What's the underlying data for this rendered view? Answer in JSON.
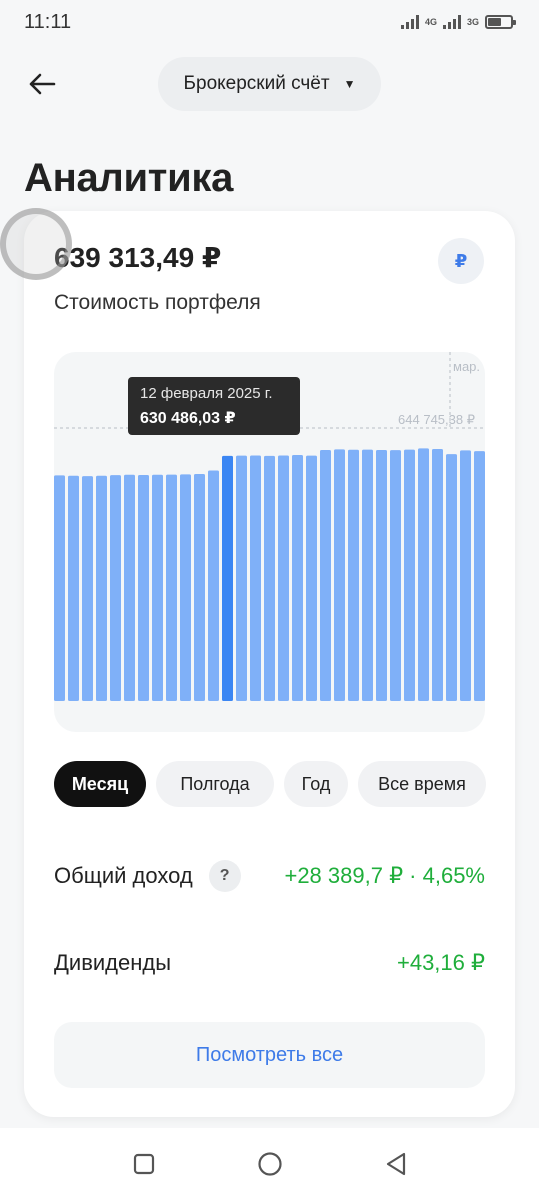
{
  "status_bar": {
    "time": "11:11",
    "network_1": "4G",
    "network_2": "3G"
  },
  "header": {
    "account_selector": "Брокерский счёт"
  },
  "page": {
    "title": "Аналитика"
  },
  "portfolio": {
    "value": "639 313,49 ₽",
    "label": "Стоимость портфеля",
    "currency_symbol": "₽"
  },
  "chart_data": {
    "type": "bar",
    "title": "",
    "x_axis_visible_label": "мар.",
    "reference_line_label": "644 745,38 ₽",
    "reference_line_value": 644745.38,
    "highlighted_index": 12,
    "tooltip": {
      "date": "12 февраля 2025 г.",
      "value": "630 486,03 ₽"
    },
    "values": [
      620500,
      620300,
      620100,
      620300,
      620600,
      620800,
      620700,
      620800,
      620900,
      621000,
      621200,
      623000,
      630486,
      630600,
      630700,
      630500,
      630700,
      630900,
      630600,
      633500,
      633800,
      633600,
      633700,
      633500,
      633400,
      633700,
      634300,
      634000,
      631400,
      633300,
      632900
    ],
    "ylim": [
      505000,
      644745.38
    ],
    "colors": {
      "bar": "#7fb0f8",
      "bar_highlight": "#3b86f3",
      "reference": "#b8bec6"
    }
  },
  "periods": [
    {
      "label": "Месяц",
      "active": true,
      "width": 92
    },
    {
      "label": "Полгода",
      "active": false,
      "width": 118
    },
    {
      "label": "Год",
      "active": false,
      "width": 64
    },
    {
      "label": "Все время",
      "active": false,
      "width": 128
    }
  ],
  "income": {
    "label": "Общий доход",
    "help": "?",
    "value": "+28 389,7 ₽ · 4,65%"
  },
  "dividends": {
    "label": "Дивиденды",
    "value": "+43,16 ₽"
  },
  "view_all": "Посмотреть все",
  "colors": {
    "accent": "#3e7be8",
    "positive": "#1fae3b"
  }
}
